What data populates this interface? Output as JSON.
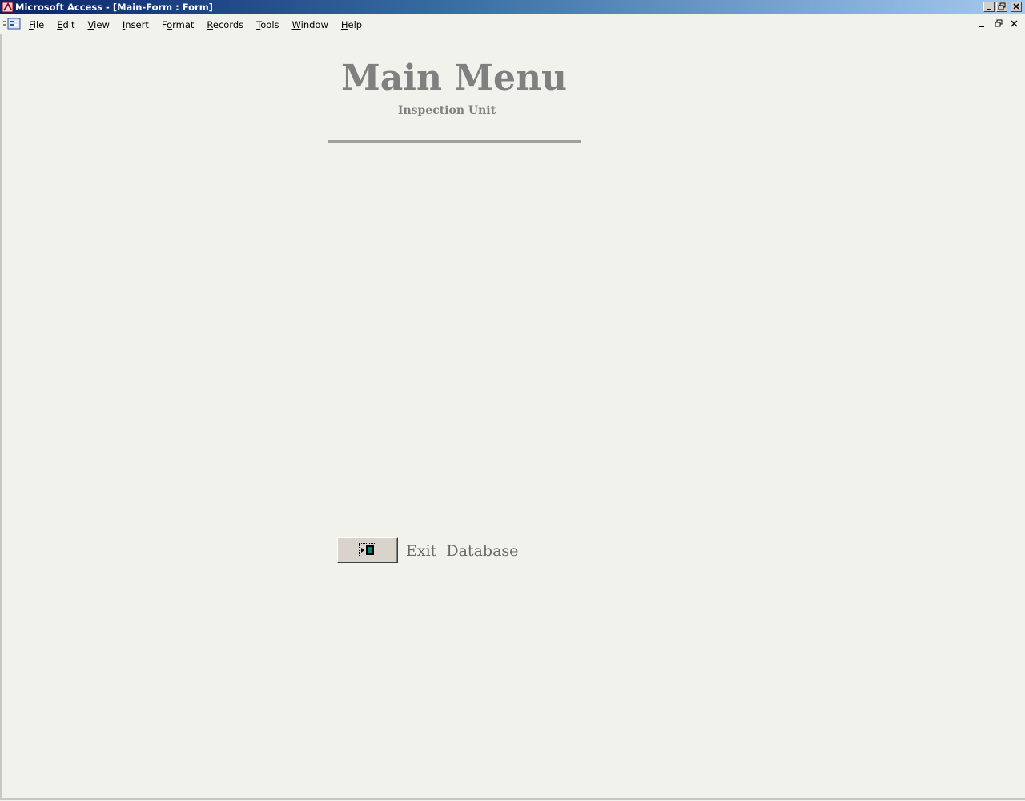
{
  "window": {
    "title": "Microsoft Access - [Main-Form : Form]"
  },
  "menu": {
    "items": [
      {
        "key": "F",
        "rest": "ile"
      },
      {
        "key": "E",
        "rest": "dit"
      },
      {
        "key": "V",
        "rest": "iew"
      },
      {
        "key": "I",
        "rest": "nsert"
      },
      {
        "key": "",
        "pre": "F",
        "key2": "o",
        "rest": "rmat"
      },
      {
        "key": "R",
        "rest": "ecords"
      },
      {
        "key": "T",
        "rest": "ools"
      },
      {
        "key": "W",
        "rest": "indow"
      },
      {
        "key": "H",
        "rest": "elp"
      }
    ]
  },
  "form": {
    "title": "Main Menu",
    "subtitle": "Inspection Unit",
    "exit_label": "Exit  Database"
  },
  "icons": {
    "app": "access-key-icon",
    "form": "form-icon",
    "exit": "exit-door-icon"
  },
  "colors": {
    "title_text": "#808080",
    "background": "#f2f2ed"
  }
}
